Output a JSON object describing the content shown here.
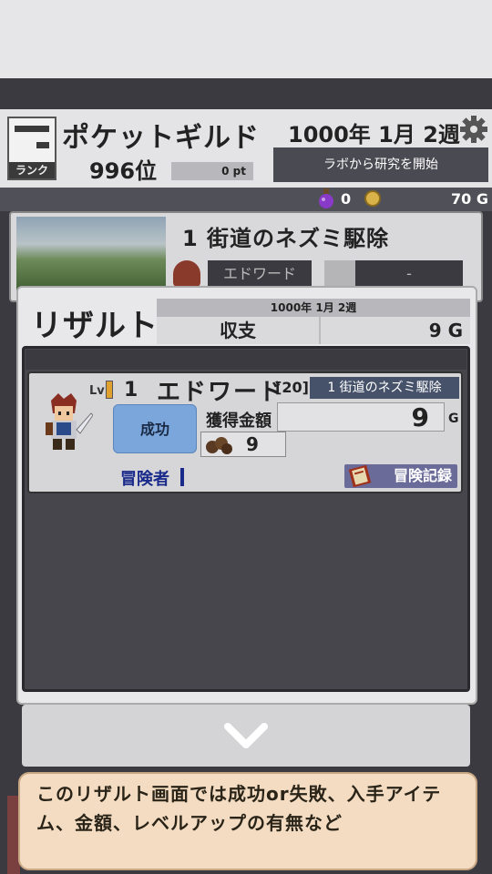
{
  "guild": {
    "name": "ポケットギルド",
    "rank_badge_label": "ランク",
    "rank_position": "996位",
    "points": "0 pt",
    "date": "1000年 1月 2週",
    "lab_button": "ラボから研究を開始"
  },
  "resources": {
    "potion_count": "0",
    "gold": "70 G"
  },
  "quest": {
    "title": "1 街道のネズミ駆除",
    "hero_name": "エドワード",
    "slot_placeholder": "-"
  },
  "result": {
    "title": "リザルト",
    "date": "1000年 1月 2週",
    "income_label": "収支",
    "income_value": "9 G",
    "adventurer": {
      "lv_label": "Lv",
      "level": "1",
      "name": "エドワード",
      "number": "[20]",
      "quest": "1 街道のネズミ駆除",
      "status": "成功",
      "earn_label": "獲得金額",
      "earn_value": "9",
      "earn_unit": "G",
      "item_count": "9",
      "adventurer_link": "冒険者",
      "record_button": "冒険記録"
    }
  },
  "tip": {
    "text": "このリザルト画面では成功or失敗、入手アイテム、金額、レベルアップの有無など"
  }
}
